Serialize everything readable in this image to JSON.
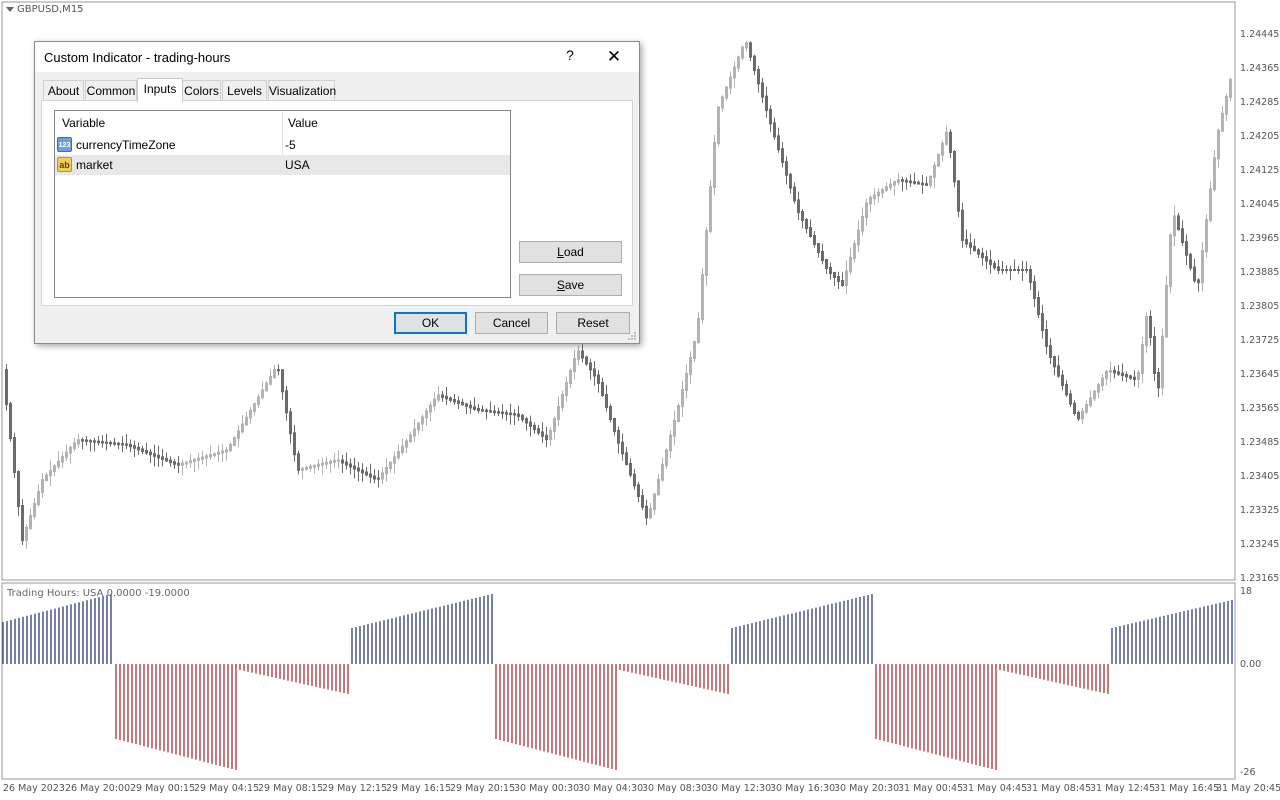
{
  "symbol": "GBPUSD,M15",
  "indicator_label": "Trading Hours: USA 0.0000 -19.0000",
  "price_axis": [
    "1.24445",
    "1.24365",
    "1.24285",
    "1.24205",
    "1.24125",
    "1.24045",
    "1.23965",
    "1.23885",
    "1.23805",
    "1.23725",
    "1.23645",
    "1.23565",
    "1.23485",
    "1.23405",
    "1.23325",
    "1.23245",
    "1.23165"
  ],
  "sub_axis": [
    "18",
    "0.00",
    "-26"
  ],
  "time_axis": [
    "26 May 2023",
    "26 May 20:00",
    "29 May 00:15",
    "29 May 04:15",
    "29 May 08:15",
    "29 May 12:15",
    "29 May 16:15",
    "29 May 20:15",
    "30 May 00:30",
    "30 May 04:30",
    "30 May 08:30",
    "30 May 12:30",
    "30 May 16:30",
    "30 May 20:30",
    "31 May 00:45",
    "31 May 04:45",
    "31 May 08:45",
    "31 May 12:45",
    "31 May 16:45",
    "31 May 20:45"
  ],
  "dialog": {
    "title": "Custom Indicator - trading-hours",
    "help": "?",
    "close": "✕",
    "tabs": [
      "About",
      "Common",
      "Inputs",
      "Colors",
      "Levels",
      "Visualization"
    ],
    "active_tab": "Inputs",
    "table": {
      "headers": [
        "Variable",
        "Value"
      ],
      "rows": [
        {
          "icon": "123",
          "name": "currencyTimeZone",
          "value": "-5"
        },
        {
          "icon": "ab",
          "name": "market",
          "value": "USA"
        }
      ]
    },
    "buttons": {
      "load": "Load",
      "save": "Save",
      "ok": "OK",
      "cancel": "Cancel",
      "reset": "Reset"
    }
  },
  "colors": {
    "bull": "#b3b3b3",
    "bear": "#6b6b6b",
    "pos_hist": "#1b2a72",
    "neg_hist": "#a31c20"
  }
}
